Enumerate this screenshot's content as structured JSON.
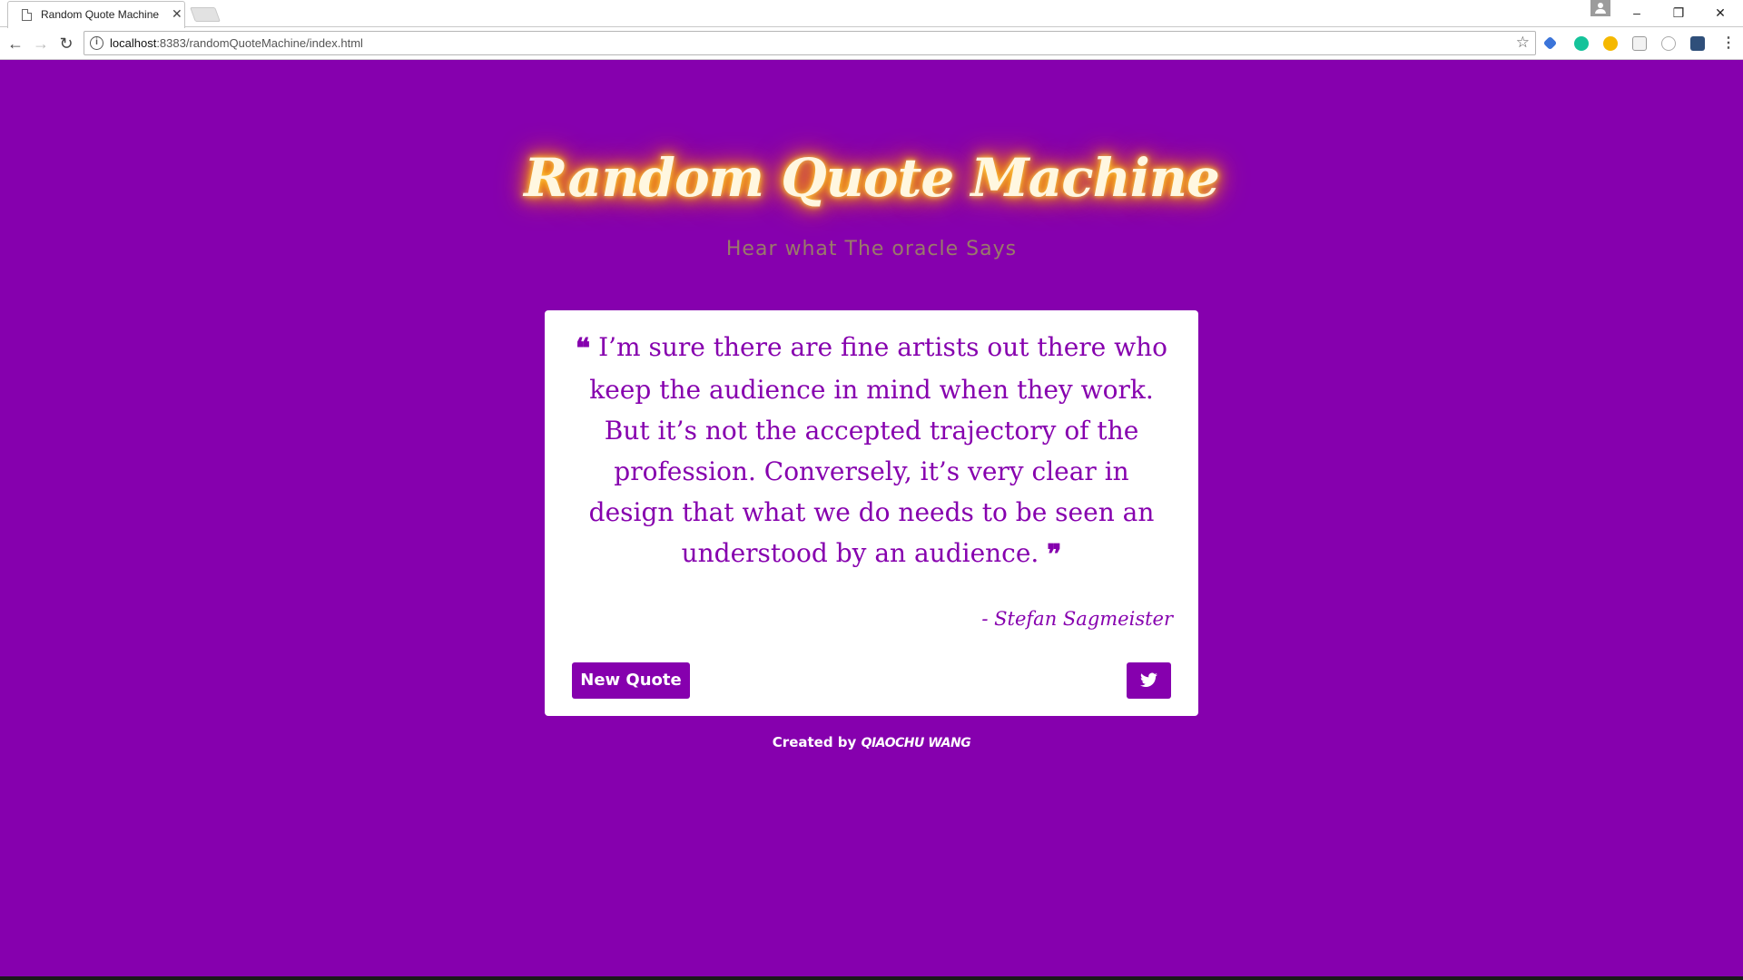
{
  "browser": {
    "tab_title": "Random Quote Machine",
    "tab_close": "✕",
    "url_host": "localhost",
    "url_rest": ":8383/randomQuoteMachine/index.html",
    "window_controls": {
      "minimize": "–",
      "restore": "❐",
      "close": "✕"
    }
  },
  "page": {
    "title": "Random Quote Machine",
    "subtitle": "Hear what The oracle Says",
    "quote_text": "I’m sure there are fine artists out there who keep the audience in mind when they work. But it’s not the accepted trajectory of the profession. Conversely, it’s very clear in design that what we do needs to be seen an understood by an audience.",
    "open_quote": "❝",
    "close_quote": "❞",
    "author": "- Stefan Sagmeister",
    "new_quote_label": "New Quote",
    "footer_prefix": "Created by",
    "footer_name": "QIAOCHU WANG"
  },
  "colors": {
    "background": "#8600ae",
    "card": "#ffffff",
    "accent": "#8600ae",
    "title_glow": "#ffb300"
  },
  "icons": {
    "tweet": "twitter-icon",
    "back": "back-arrow-icon",
    "forward": "forward-arrow-icon",
    "reload": "reload-icon",
    "star": "bookmark-star-icon"
  }
}
